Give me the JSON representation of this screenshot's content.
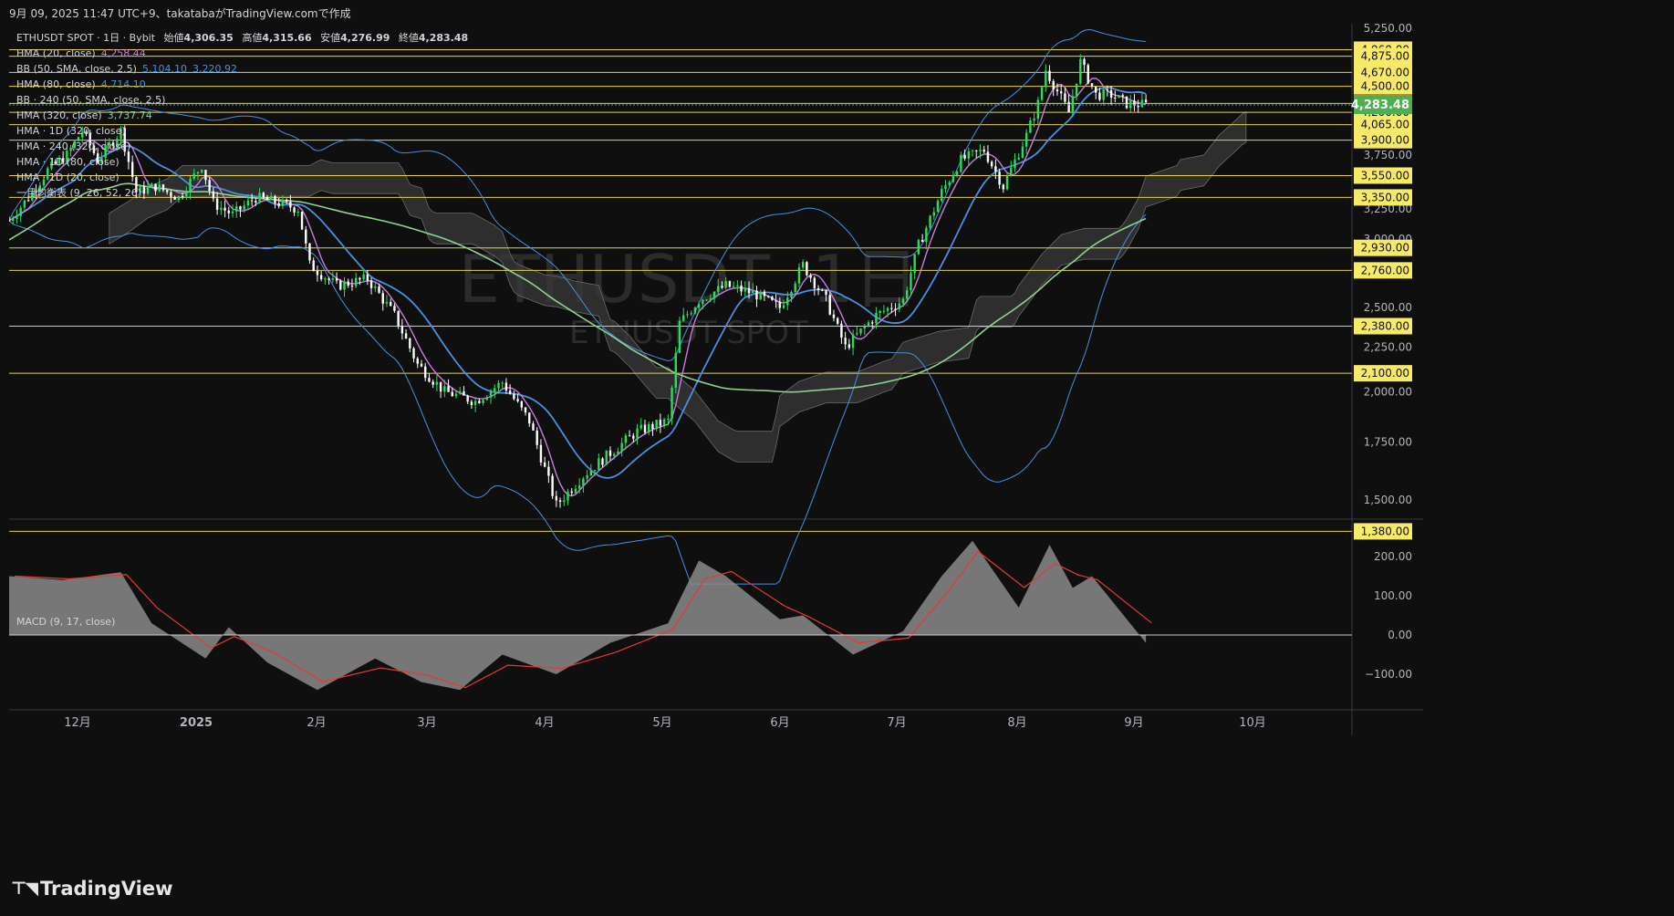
{
  "caption": "9月 09, 2025 11:47 UTC+9、takatabaがTradingView.comで作成",
  "brand": "TradingView",
  "brand_logo": "tradingview-logo-icon",
  "watermark": {
    "title": "ETHUSDT, 1日",
    "subtitle": "ETHUSDT SPOT"
  },
  "legend": {
    "symbol": "ETHUSDT SPOT · 1日 · Bybit",
    "ohlc": [
      {
        "label": "始値",
        "value": "4,306.35"
      },
      {
        "label": "高値",
        "value": "4,315.66"
      },
      {
        "label": "安値",
        "value": "4,276.99"
      },
      {
        "label": "終値",
        "value": "4,283.48"
      }
    ],
    "indicators": [
      {
        "name": "HMA (20, close)",
        "values": [
          "4,258.44"
        ],
        "color": "#c77ddb"
      },
      {
        "name": "BB (50, SMA, close, 2.5)",
        "values": [
          "5,104.10",
          "3,220.92"
        ],
        "color": "#4a8fe0"
      },
      {
        "name": "HMA (80, close)",
        "values": [
          "4,714.10"
        ],
        "color": "#4a8fe0"
      },
      {
        "name": "BB · 240 (50, SMA, close, 2.5)",
        "values": [],
        "color": "#d1d4dc"
      },
      {
        "name": "HMA (320, close)",
        "values": [
          "3,737.74"
        ],
        "color": "#8fd18f"
      },
      {
        "name": "HMA · 1D (320, close)",
        "values": [],
        "color": "#d1d4dc"
      },
      {
        "name": "HMA · 240 (320, close)",
        "values": [],
        "color": "#d1d4dc"
      },
      {
        "name": "HMA · 1D (80, close)",
        "values": [],
        "color": "#d1d4dc"
      },
      {
        "name": "HMA · 1D (20, close)",
        "values": [],
        "color": "#d1d4dc"
      },
      {
        "name": "一目均衡表 (9, 26, 52, 26)",
        "values": [],
        "color": "#d1d4dc"
      }
    ],
    "macd_label": "MACD (9, 17, close)"
  },
  "colors": {
    "background": "#0f0f0f",
    "up": "#26e05a",
    "down": "#ffffff",
    "level_line": "#e6d34a",
    "level_label_bg": "#f7e96a",
    "last_price_bg": "#4caf50",
    "hma20": "#c77ddb",
    "hma80": "#4a8fe0",
    "hma320": "#8fd18f",
    "bb": "#4a8fe0",
    "cloud": "#3a3a3a",
    "macd_signal": "#e53935",
    "macd_hist": "#8a8a8a"
  },
  "chart_data": [
    {
      "type": "candlestick",
      "title": "ETHUSDT, 1日",
      "x_ticks": [
        "12月",
        "2025",
        "2月",
        "3月",
        "4月",
        "5月",
        "6月",
        "7月",
        "8月",
        "9月",
        "10月"
      ],
      "y_scale": "log",
      "y_ticks": [
        1500,
        1750,
        2000,
        2250,
        2500,
        3000,
        3250,
        3750,
        4300,
        4500,
        5250
      ],
      "y_tick_labels": [
        "1,500.00",
        "1,750.00",
        "2,000.00",
        "2,250.00",
        "2,500.00",
        "3,000.00",
        "3,250.00",
        "3,750.00",
        "4,300.00",
        "4,500.00",
        "5,250.00"
      ],
      "ylim": [
        1380,
        5350
      ],
      "grid": false,
      "last_price": {
        "value": 4283.48,
        "label": "4,283.48"
      },
      "horizontal_levels": [
        {
          "value": 4960,
          "label": "4,960.00"
        },
        {
          "value": 4875,
          "label": "4,875.00"
        },
        {
          "value": 4670,
          "label": "4,670.00"
        },
        {
          "value": 4500,
          "label": "4,500.00"
        },
        {
          "value": 4300,
          "label": "4,300.00"
        },
        {
          "value": 4200,
          "label": "4,200.00"
        },
        {
          "value": 4065,
          "label": "4,065.00"
        },
        {
          "value": 3900,
          "label": "3,900.00"
        },
        {
          "value": 3550,
          "label": "3,550.00"
        },
        {
          "value": 3350,
          "label": "3,350.00"
        },
        {
          "value": 2930,
          "label": "2,930.00"
        },
        {
          "value": 2760,
          "label": "2,760.00"
        },
        {
          "value": 2380,
          "label": "2,380.00"
        },
        {
          "value": 2100,
          "label": "2,100.00"
        },
        {
          "value": 1380,
          "label": "1,380.00"
        }
      ],
      "close_path": [
        [
          "2024-11-17",
          3150
        ],
        [
          "2024-11-22",
          3350
        ],
        [
          "2024-11-27",
          3600
        ],
        [
          "2024-12-02",
          3750
        ],
        [
          "2024-12-06",
          4000
        ],
        [
          "2024-12-10",
          3700
        ],
        [
          "2024-12-16",
          4000
        ],
        [
          "2024-12-20",
          3400
        ],
        [
          "2024-12-25",
          3450
        ],
        [
          "2024-12-31",
          3350
        ],
        [
          "2025-01-06",
          3650
        ],
        [
          "2025-01-09",
          3300
        ],
        [
          "2025-01-14",
          3200
        ],
        [
          "2025-01-20",
          3350
        ],
        [
          "2025-01-26",
          3300
        ],
        [
          "2025-01-31",
          3250
        ],
        [
          "2025-02-03",
          2800
        ],
        [
          "2025-02-10",
          2650
        ],
        [
          "2025-02-18",
          2700
        ],
        [
          "2025-02-25",
          2450
        ],
        [
          "2025-03-03",
          2150
        ],
        [
          "2025-03-10",
          2000
        ],
        [
          "2025-03-18",
          1950
        ],
        [
          "2025-03-25",
          2050
        ],
        [
          "2025-04-01",
          1850
        ],
        [
          "2025-04-08",
          1480
        ],
        [
          "2025-04-15",
          1600
        ],
        [
          "2025-04-22",
          1700
        ],
        [
          "2025-04-29",
          1800
        ],
        [
          "2025-05-07",
          1850
        ],
        [
          "2025-05-10",
          2400
        ],
        [
          "2025-05-15",
          2550
        ],
        [
          "2025-05-22",
          2650
        ],
        [
          "2025-05-29",
          2600
        ],
        [
          "2025-06-05",
          2500
        ],
        [
          "2025-06-11",
          2800
        ],
        [
          "2025-06-17",
          2550
        ],
        [
          "2025-06-22",
          2250
        ],
        [
          "2025-06-30",
          2450
        ],
        [
          "2025-07-07",
          2550
        ],
        [
          "2025-07-11",
          2950
        ],
        [
          "2025-07-17",
          3400
        ],
        [
          "2025-07-22",
          3700
        ],
        [
          "2025-07-28",
          3800
        ],
        [
          "2025-08-02",
          3450
        ],
        [
          "2025-08-08",
          3950
        ],
        [
          "2025-08-11",
          4300
        ],
        [
          "2025-08-13",
          4700
        ],
        [
          "2025-08-19",
          4200
        ],
        [
          "2025-08-22",
          4800
        ],
        [
          "2025-08-26",
          4400
        ],
        [
          "2025-08-30",
          4400
        ],
        [
          "2025-09-03",
          4300
        ],
        [
          "2025-09-08",
          4283.48
        ]
      ]
    },
    {
      "type": "area",
      "title": "MACD (9, 17, close)",
      "y_ticks": [
        200,
        100,
        0,
        -100
      ],
      "y_tick_labels": [
        "200.00",
        "100.00",
        "0.00",
        "−100.00"
      ],
      "ylim": [
        -190,
        250
      ],
      "series": [
        {
          "name": "MACD",
          "values": [
            [
              "2024-11-17",
              150
            ],
            [
              "2024-12-01",
              140
            ],
            [
              "2024-12-16",
              160
            ],
            [
              "2024-12-24",
              30
            ],
            [
              "2025-01-07",
              -60
            ],
            [
              "2025-01-13",
              20
            ],
            [
              "2025-01-23",
              -70
            ],
            [
              "2025-02-05",
              -140
            ],
            [
              "2025-02-20",
              -60
            ],
            [
              "2025-03-04",
              -120
            ],
            [
              "2025-03-14",
              -140
            ],
            [
              "2025-03-25",
              -50
            ],
            [
              "2025-04-08",
              -100
            ],
            [
              "2025-04-22",
              -20
            ],
            [
              "2025-05-07",
              30
            ],
            [
              "2025-05-15",
              190
            ],
            [
              "2025-05-22",
              150
            ],
            [
              "2025-06-05",
              40
            ],
            [
              "2025-06-11",
              50
            ],
            [
              "2025-06-24",
              -50
            ],
            [
              "2025-07-07",
              10
            ],
            [
              "2025-07-17",
              150
            ],
            [
              "2025-07-25",
              240
            ],
            [
              "2025-08-06",
              70
            ],
            [
              "2025-08-14",
              230
            ],
            [
              "2025-08-20",
              120
            ],
            [
              "2025-08-25",
              150
            ],
            [
              "2025-09-08",
              -20
            ]
          ]
        }
      ]
    }
  ]
}
